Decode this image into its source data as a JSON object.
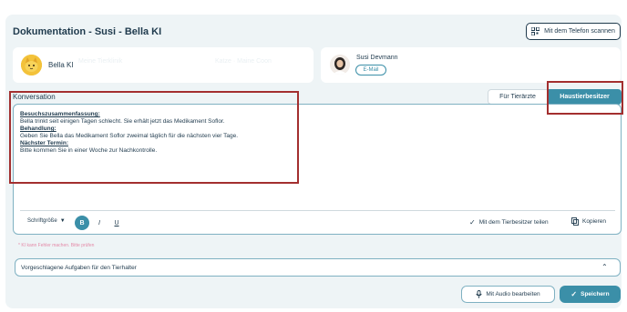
{
  "header": {
    "title": "Dokumentation - Susi - Bella KI",
    "scan_button": "Mit dem Telefon scannen"
  },
  "pet_card": {
    "name": "Bella KI",
    "faded_text_1": "Meine Tierklinik",
    "faded_text_2": "Katze · Maine Coon"
  },
  "owner_card": {
    "name": "Susi Devmann",
    "email_badge": "E-Mail"
  },
  "conversation": {
    "label": "Konversation",
    "tabs": [
      {
        "label": "Für Tierärzte",
        "active": false
      },
      {
        "label": "Haustierbesitzer",
        "active": true
      }
    ],
    "note": {
      "summary_heading": "Besuchszusammenfassung:",
      "summary_text": "Bella trinkt seit einigen Tagen schlecht. Sie erhält jetzt das Medikament Soflor.",
      "treatment_heading": "Behandlung:",
      "treatment_text": "Geben Sie Bella das Medikament Soflor zweimal täglich für die nächsten vier Tage.",
      "next_heading": "Nächster Termin:",
      "next_text": "Bitte kommen Sie in einer Woche zur Nachkontrolle."
    }
  },
  "toolbar": {
    "font_size_label": "Schriftgröße",
    "bold": "B",
    "italic": "I",
    "underline": "U",
    "share_label": "Mit dem Tierbesitzer teilen",
    "copy_label": "Kopieren"
  },
  "disclaimer": "* KI kann Fehler machen. Bitte prüfen",
  "tasks": {
    "label": "Vorgeschlagene Aufgaben für den Tierhalter"
  },
  "footer": {
    "audio_button": "Mit Audio bearbeiten",
    "save_button": "Speichern"
  },
  "colors": {
    "accent": "#3b8fa8",
    "highlight": "#a32f2f",
    "text": "#1f3a4d",
    "panel_bg": "#eef4f6"
  }
}
